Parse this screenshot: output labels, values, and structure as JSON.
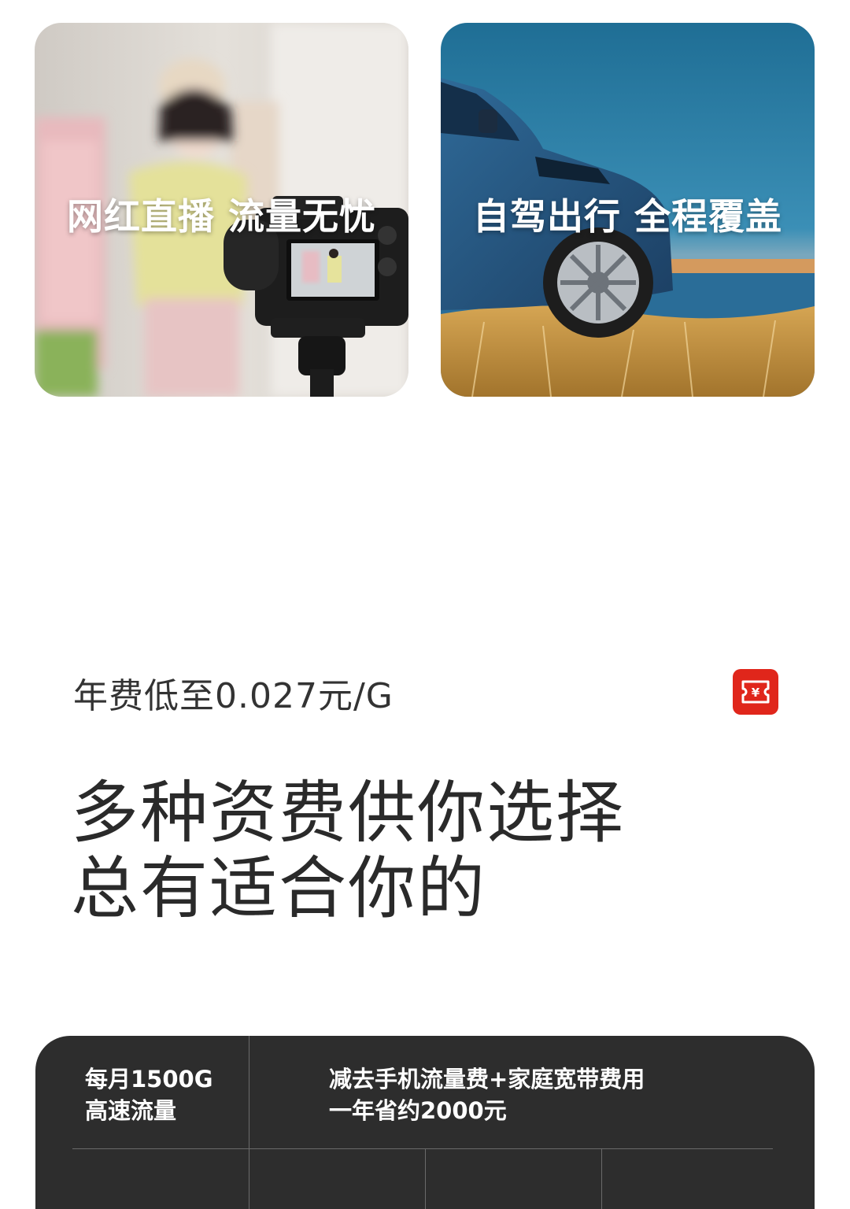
{
  "cards": [
    {
      "caption": "网红直播  流量无忧",
      "scene": "live-streaming-camera"
    },
    {
      "caption": "自驾出行  全程覆盖",
      "scene": "blue-suv-by-sea"
    }
  ],
  "promo": {
    "rate_text": "年费低至0.027元/G",
    "badge_icon": "yuan-ticket-icon",
    "badge_color": "#e0261b",
    "headline_line1": "多种资费供你选择",
    "headline_line2": "总有适合你的"
  },
  "panel": {
    "background": "#2d2d2d",
    "feature_line1": "每月1500G",
    "feature_line2": "高速流量",
    "saving_line1": "减去手机流量费+家庭宽带费用",
    "saving_line2": "一年省约2000元"
  }
}
